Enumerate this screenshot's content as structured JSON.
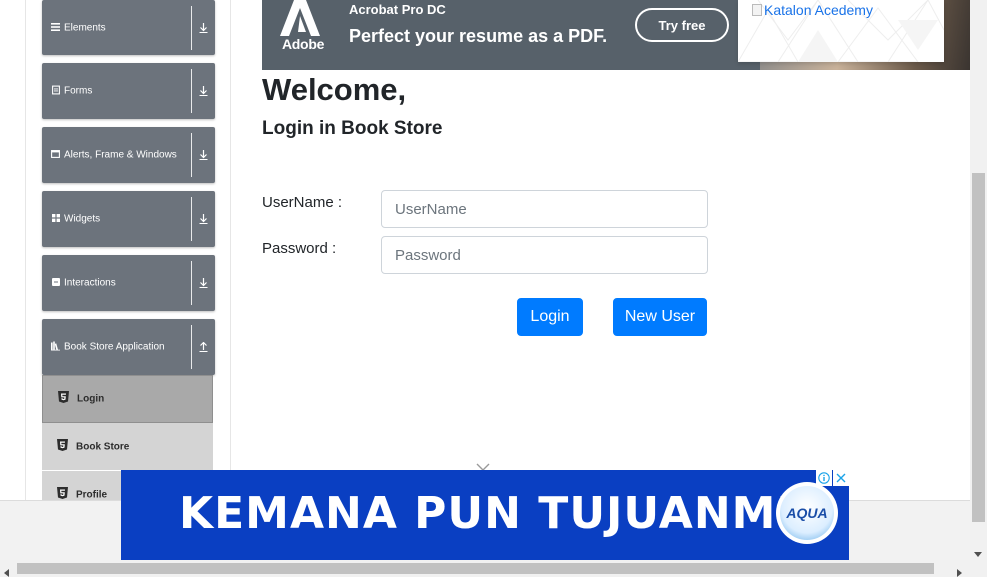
{
  "sidebar": {
    "groups": [
      {
        "label": "Elements",
        "icon": "hamburger-icon",
        "arrow": "download-arrow-icon"
      },
      {
        "label": "Forms",
        "icon": "document-icon",
        "arrow": "download-arrow-icon"
      },
      {
        "label": "Alerts, Frame & Windows",
        "icon": "window-icon",
        "arrow": "download-arrow-icon"
      },
      {
        "label": "Widgets",
        "icon": "grid-icon",
        "arrow": "download-arrow-icon"
      },
      {
        "label": "Interactions",
        "icon": "square-icon",
        "arrow": "download-arrow-icon"
      },
      {
        "label": "Book Store Application",
        "icon": "books-icon",
        "arrow": "upload-arrow-icon"
      }
    ],
    "sub_items": [
      {
        "label": "Login",
        "icon": "html5-icon",
        "active": true
      },
      {
        "label": "Book Store",
        "icon": "html5-icon",
        "active": false
      },
      {
        "label": "Profile",
        "icon": "html5-icon",
        "active": false
      }
    ]
  },
  "top_ad": {
    "brand": "Adobe",
    "product": "Acrobat Pro DC",
    "headline": "Perfect your resume as a PDF.",
    "cta": "Try free",
    "colors": {
      "background": "#57616a"
    }
  },
  "katalon_ad": {
    "alt_text": "Katalon Acedemy"
  },
  "main": {
    "welcome": "Welcome,",
    "subtitle": "Login in Book Store",
    "username_label": "UserName :",
    "username_placeholder": "UserName",
    "password_label": "Password :",
    "password_placeholder": "Password",
    "login_button": "Login",
    "new_user_button": "New User",
    "colors": {
      "primary": "#007bff"
    }
  },
  "bottom_ad": {
    "slogan": "KEMANA PUN TUJUANMU",
    "brand": "AQUA",
    "colors": {
      "background": "#0a3fc2"
    }
  }
}
